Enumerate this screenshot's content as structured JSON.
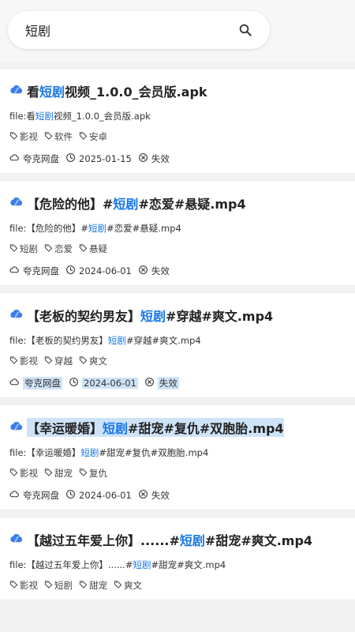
{
  "search": {
    "value": "短剧",
    "placeholder": ""
  },
  "results": [
    {
      "title_pre": "看",
      "title_hl": "短剧",
      "title_post": "视频_1.0.0_会员版.apk",
      "file_prefix": "file:看",
      "file_hl": "短剧",
      "file_post": "视频_1.0.0_会员版.apk",
      "tags": [
        "影视",
        "软件",
        "安卓"
      ],
      "source": "夸克网盘",
      "date": "2025-01-15",
      "status": "失效"
    },
    {
      "title_pre": "【危险的他】#",
      "title_hl": "短剧",
      "title_post": "#恋爱#悬疑.mp4",
      "file_prefix": "file:【危险的他】#",
      "file_hl": "短剧",
      "file_post": "#恋爱#悬疑.mp4",
      "tags": [
        "短剧",
        "恋爱",
        "悬疑"
      ],
      "source": "夸克网盘",
      "date": "2024-06-01",
      "status": "失效"
    },
    {
      "title_pre": "【老板的契约男友】",
      "title_hl": "短剧",
      "title_post": "#穿越#爽文.mp4",
      "file_prefix": "file:【老板的契约男友】",
      "file_hl": "短剧",
      "file_post": "#穿越#爽文.mp4",
      "tags": [
        "影视",
        "穿越",
        "爽文"
      ],
      "source": "夸克网盘",
      "date": "2024-06-01",
      "status": "失效"
    },
    {
      "title_pre": "【幸运暖婚】",
      "title_hl": "短剧",
      "title_post": "#甜宠#复仇#双胞胎.mp4",
      "file_prefix": "file:【幸运暖婚】",
      "file_hl": "短剧",
      "file_post": "#甜宠#复仇#双胞胎.mp4",
      "tags": [
        "影视",
        "甜宠",
        "复仇"
      ],
      "source": "夸克网盘",
      "date": "2024-06-01",
      "status": "失效"
    },
    {
      "title_pre": "【越过五年爱上你】......#",
      "title_hl": "短剧",
      "title_post": "#甜宠#爽文.mp4",
      "file_prefix": "file:【越过五年爱上你】......#",
      "file_hl": "短剧",
      "file_post": "#甜宠#爽文.mp4",
      "tags": [
        "影视",
        "短剧",
        "甜宠",
        "爽文"
      ],
      "source": "",
      "date": "",
      "status": ""
    }
  ],
  "colors": {
    "highlight": "#1677e6",
    "selection": "#cfe3f8"
  }
}
